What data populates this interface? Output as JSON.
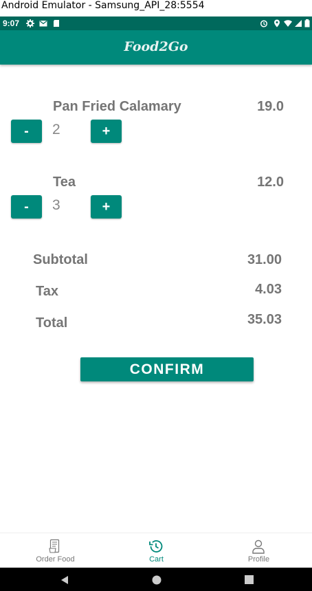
{
  "window": {
    "title": "Android Emulator - Samsung_API_28:5554"
  },
  "status_bar": {
    "time": "9:07"
  },
  "app_bar": {
    "title": "Food2Go"
  },
  "cart": {
    "items": [
      {
        "name": "Pan Fried Calamary",
        "price": "19.0",
        "qty": "2"
      },
      {
        "name": "Tea",
        "price": "12.0",
        "qty": "3"
      }
    ],
    "decrement_label": "-",
    "increment_label": "+"
  },
  "summary": {
    "subtotal_label": "Subtotal",
    "subtotal_value": "31.00",
    "tax_label": "Tax",
    "tax_value": "4.03",
    "total_label": "Total",
    "total_value": "35.03"
  },
  "confirm_label": "CONFIRM",
  "bottom_nav": {
    "items": [
      {
        "label": "Order Food",
        "icon": "order-food-icon"
      },
      {
        "label": "Cart",
        "icon": "history-icon",
        "active": true
      },
      {
        "label": "Profile",
        "icon": "person-icon"
      }
    ]
  },
  "colors": {
    "primary": "#00897b",
    "primary_dark": "#00695c",
    "text": "#757575"
  }
}
